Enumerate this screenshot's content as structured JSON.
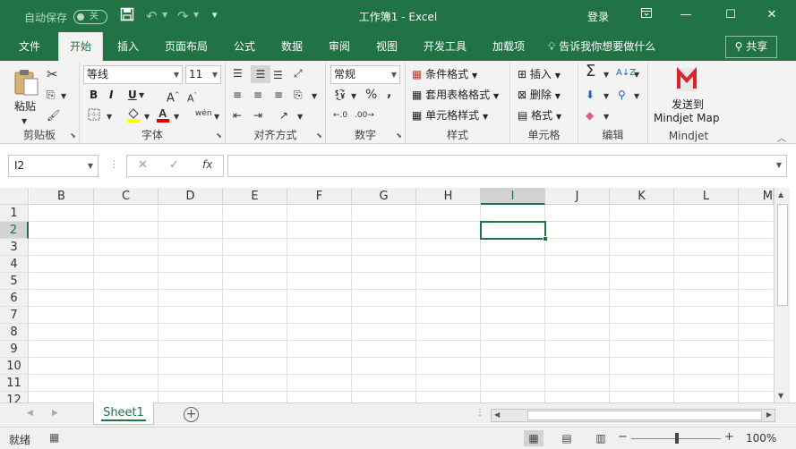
{
  "titlebar": {
    "autosave_label": "自动保存",
    "autosave_state": "关",
    "doc_title": "工作簿1  -  Excel",
    "login_label": "登录"
  },
  "tabs": [
    {
      "label": "文件"
    },
    {
      "label": "开始"
    },
    {
      "label": "插入"
    },
    {
      "label": "页面布局"
    },
    {
      "label": "公式"
    },
    {
      "label": "数据"
    },
    {
      "label": "审阅"
    },
    {
      "label": "视图"
    },
    {
      "label": "开发工具"
    },
    {
      "label": "加载项"
    }
  ],
  "active_tab": "开始",
  "tell_me": "告诉我你想要做什么",
  "share_label": "共享",
  "ribbon": {
    "clipboard": {
      "label": "剪贴板",
      "paste_label": "粘贴"
    },
    "font": {
      "label": "字体",
      "font_name": "等线",
      "font_size": "11",
      "bold": "B",
      "italic": "I",
      "underline": "U",
      "phonetic": "wén"
    },
    "alignment": {
      "label": "对齐方式"
    },
    "number": {
      "label": "数字",
      "format": "常规"
    },
    "styles": {
      "label": "样式",
      "conditional": "条件格式",
      "table_format": "套用表格格式",
      "cell_styles": "单元格样式"
    },
    "cells": {
      "label": "单元格",
      "insert": "插入",
      "delete": "删除",
      "format": "格式"
    },
    "editing": {
      "label": "编辑"
    },
    "mindjet": {
      "label": "Mindjet",
      "send_line1": "发送到",
      "send_line2": "Mindjet Map"
    }
  },
  "formula_bar": {
    "name_box": "I2",
    "value": ""
  },
  "grid": {
    "columns": [
      "B",
      "C",
      "D",
      "E",
      "F",
      "G",
      "H",
      "I",
      "J",
      "K",
      "L",
      "M"
    ],
    "rows": [
      "1",
      "2",
      "3",
      "4",
      "5",
      "6",
      "7",
      "8",
      "9",
      "10",
      "11",
      "12"
    ],
    "selected_column": "I",
    "selected_row": "2"
  },
  "sheets": [
    {
      "name": "Sheet1"
    }
  ],
  "status": {
    "ready": "就绪",
    "zoom": "100%"
  },
  "colors": {
    "accent": "#217346",
    "ribbon_bg": "#f3f3f3"
  }
}
